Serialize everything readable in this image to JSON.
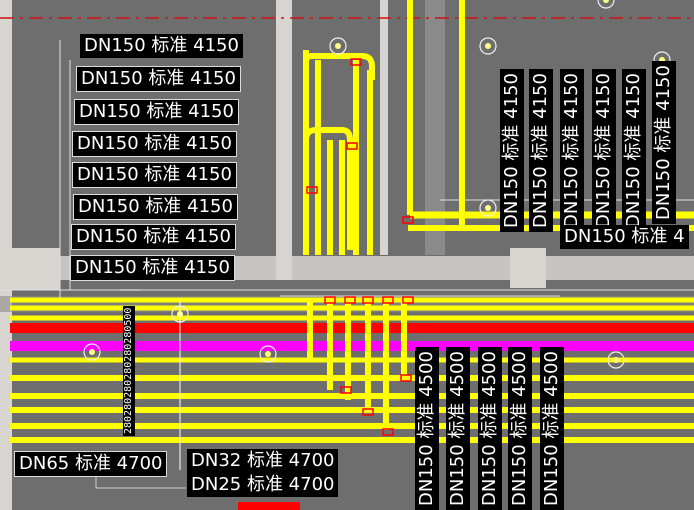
{
  "drawing": {
    "colors": {
      "background": "#6e6e6e",
      "pipe_gas": "#ffff00",
      "pipe_fire": "#ff0000",
      "pipe_magenta": "#ff00ff",
      "wall": "#d8d4d0",
      "label_bg": "#000000",
      "label_text": "#ffffff",
      "valve": "#ff0000",
      "axis_line": "#d01010"
    },
    "labels_left_stack": [
      "DN150 标准 4150",
      "DN150 标准 4150",
      "DN150 标准 4150",
      "DN150 标准 4150",
      "DN150 标准 4150",
      "DN150 标准 4150",
      "DN150 标准 4150",
      "DN150 标准 4150"
    ],
    "labels_right_vertical": [
      "DN150 标准 4150",
      "DN150 标准 4150",
      "DN150 标准 4150",
      "DN150 标准 4150",
      "DN150 标准 4150",
      "DN150 标准 4150"
    ],
    "label_right_horizontal": "DN150 标准 4",
    "labels_bottom_vertical": [
      "DN150 标准 4500",
      "DN150 标准 4500",
      "DN150 标准 4500",
      "DN150 标准 4500",
      "DN150 标准 4500"
    ],
    "label_dn65": "DN65 标准 4700",
    "label_dn32": "DN32 标准 4700",
    "label_dn25": "DN25 标准 4700",
    "dim_chain": "280280280280280280500"
  }
}
